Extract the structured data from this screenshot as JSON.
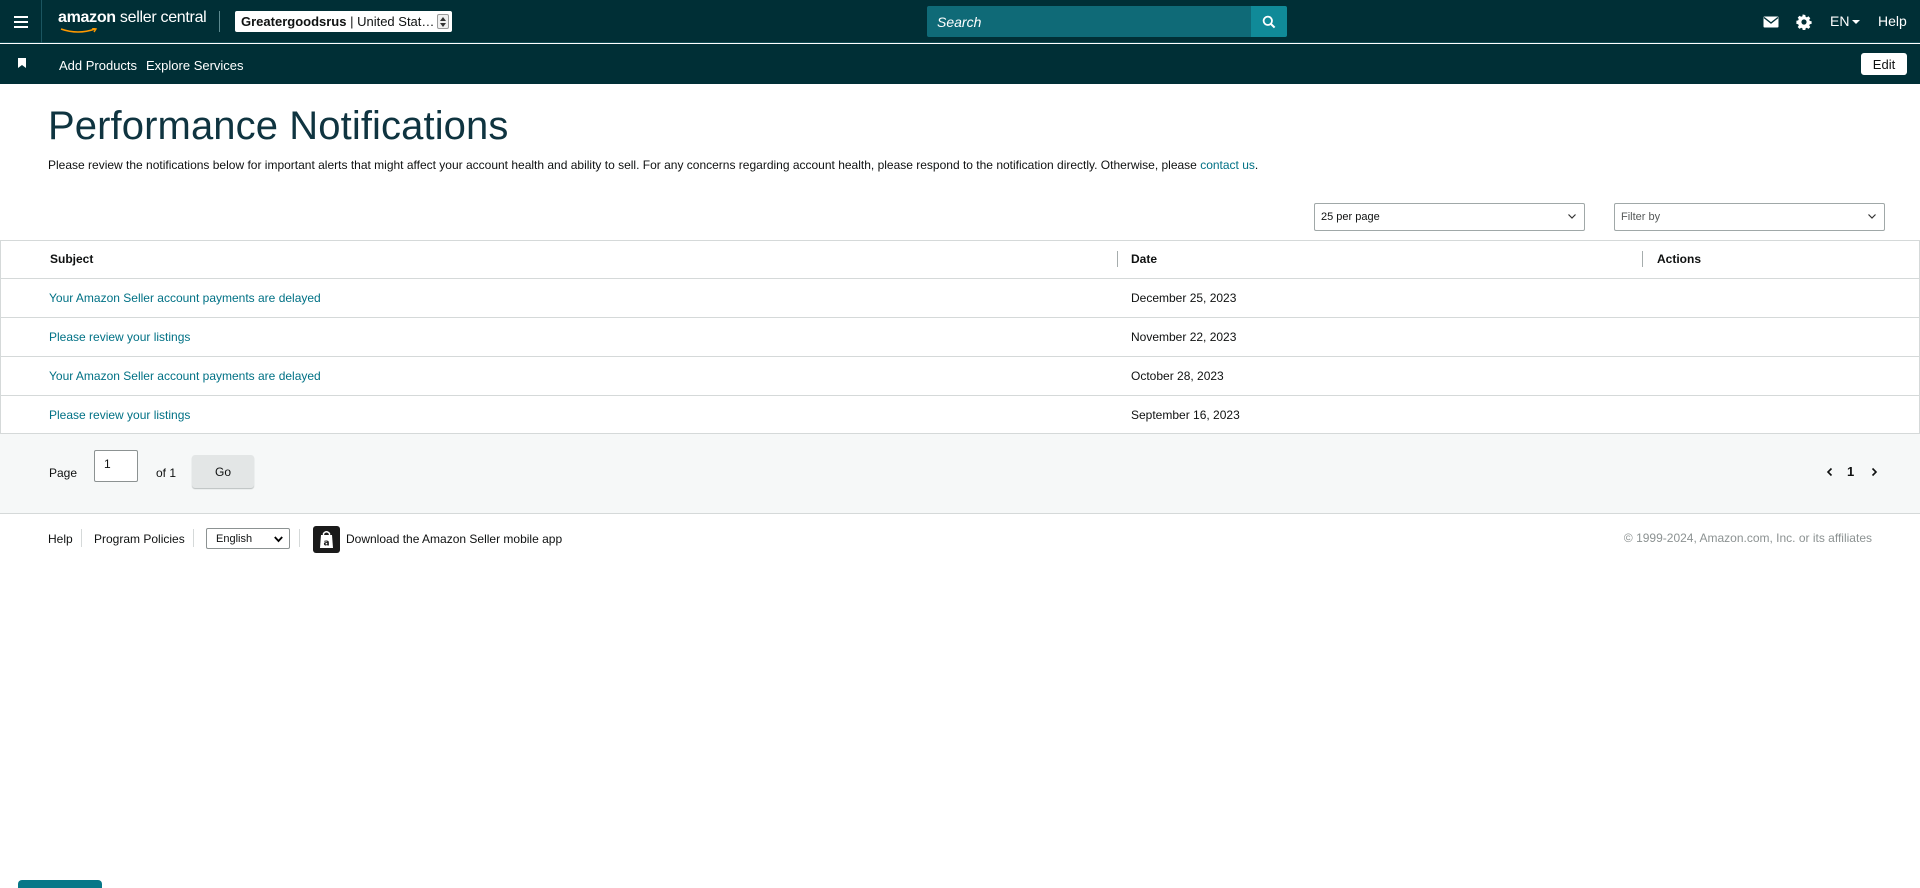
{
  "topbar": {
    "logo_bold": "amazon",
    "logo_rest": " seller central",
    "account_name": "Greatergoodsrus",
    "account_region": " | United Stat…",
    "search_placeholder": "Search",
    "language": "EN",
    "help_label": "Help",
    "icons": [
      "menu-icon",
      "mail-icon",
      "gear-icon",
      "search-icon"
    ]
  },
  "navbar": {
    "links": [
      "Add Products",
      "Explore Services"
    ],
    "edit_label": "Edit"
  },
  "header": {
    "title": "Performance Notifications",
    "intro_text": "Please review the notifications below for important alerts that might affect your account health and ability to sell. For any concerns regarding account health, please respond to the notification directly. Otherwise, please ",
    "contact_link": "contact us",
    "intro_end": "."
  },
  "controls": {
    "per_page": "25 per page",
    "filter_placeholder": "Filter by"
  },
  "table": {
    "columns": [
      "Subject",
      "Date",
      "Actions"
    ],
    "rows": [
      {
        "subject": "Your Amazon Seller account payments are delayed",
        "date": "December 25, 2023"
      },
      {
        "subject": "Please review your listings",
        "date": "November 22, 2023"
      },
      {
        "subject": "Your Amazon Seller account payments are delayed",
        "date": "October 28, 2023"
      },
      {
        "subject": "Please review your listings",
        "date": "September 16, 2023"
      }
    ]
  },
  "pagination": {
    "page_label": "Page",
    "page_value": "1",
    "of_label": "of 1",
    "go_label": "Go",
    "current_page": "1"
  },
  "footer": {
    "help": "Help",
    "program_policies": "Program Policies",
    "language_option": "English",
    "app_link": "Download the Amazon Seller mobile app",
    "copyright": "© 1999-2024, Amazon.com, Inc. or its affiliates"
  },
  "colors": {
    "header_bg": "#002f36",
    "link": "#007185",
    "title": "#0f3440"
  }
}
